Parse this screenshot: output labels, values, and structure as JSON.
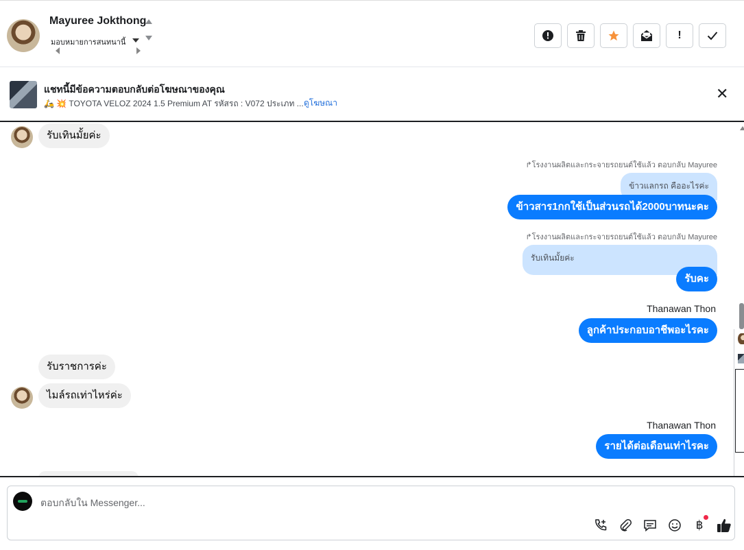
{
  "header": {
    "contact_name": "Mayuree Jokthong",
    "assign_label": "มอบหมายการสนทนานี้",
    "actions": [
      {
        "name": "spam-button",
        "icon": "alert-circle-icon"
      },
      {
        "name": "delete-button",
        "icon": "trash-icon"
      },
      {
        "name": "star-button",
        "icon": "star-icon"
      },
      {
        "name": "unread-button",
        "icon": "mail-open-icon"
      },
      {
        "name": "follow-up-button",
        "icon": "exclamation-icon"
      },
      {
        "name": "done-button",
        "icon": "check-icon"
      }
    ]
  },
  "ad_banner": {
    "title": "แชทนี้มีข้อความตอบกลับต่อโฆษณาของคุณ",
    "subtitle": "🛵 💥 TOYOTA VELOZ 2024 1.5 Premium AT รหัสรถ : V072 ประเภท ...",
    "link_label": "ดูโฆษณา"
  },
  "messages": {
    "m1": "รับเทินมั้ยค่ะ",
    "reply1_meta": "โรงงานผลิตและกระจายรถยนต์ใช้แล้ว ตอบกลับ Mayuree",
    "reply1_quote": "ข้าวแลกรถ คืออะไรค่ะ",
    "m2": "ข้าวสาร1กกใช้เป็นส่วนรถได้2000บาทนะคะ",
    "reply2_meta": "โรงงานผลิตและกระจายรถยนต์ใช้แล้ว ตอบกลับ Mayuree",
    "reply2_quote": "รับเทินมั้ยค่ะ",
    "m3": "รับคะ",
    "sender1": "Thanawan Thon",
    "m4": "ลูกค้าประกอบอาชีพอะไรคะ",
    "m5": "รับราชการค่ะ",
    "m6": "ไมล์รถเท่าไหร่ค่ะ",
    "sender2": "Thanawan Thon",
    "m7": "รายได้ต่อเดือนเท่าไรคะ"
  },
  "composer": {
    "placeholder": "ตอบกลับใน Messenger...",
    "tools": [
      "phone-plus-icon",
      "attachment-icon",
      "saved-reply-icon",
      "emoji-icon",
      "baht-payment-icon",
      "thumbs-up-icon"
    ]
  },
  "colors": {
    "outgoing": "#0a7cff",
    "incoming": "#f0f0f0",
    "quoted": "#cce4ff",
    "star": "#f7923a",
    "link": "#216fdb"
  }
}
